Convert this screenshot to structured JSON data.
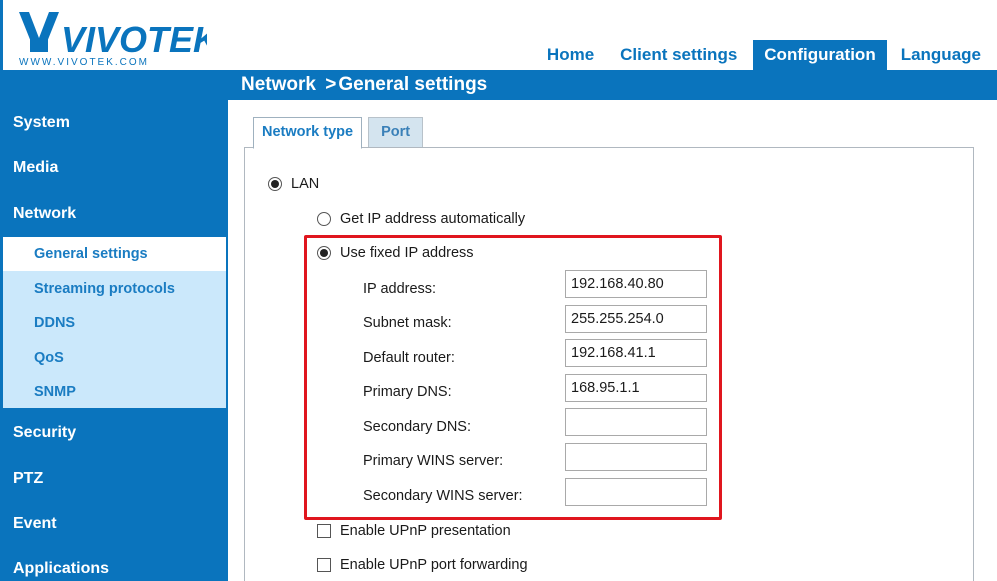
{
  "brand": {
    "name": "VIVOTEK",
    "url_text": "WWW.VIVOTEK.COM",
    "color": "#0a74bd"
  },
  "nav": {
    "home": "Home",
    "client_settings": "Client settings",
    "configuration": "Configuration",
    "language": "Language"
  },
  "title": {
    "section": "Network",
    "separator": ">",
    "page": "General settings"
  },
  "sidebar": {
    "main_top": [
      "System",
      "Media",
      "Network"
    ],
    "sub": [
      "General settings",
      "Streaming protocols",
      "DDNS",
      "QoS",
      "SNMP"
    ],
    "main_bottom": [
      "Security",
      "PTZ",
      "Event",
      "Applications"
    ]
  },
  "tabs": {
    "network_type": "Network type",
    "port": "Port"
  },
  "form": {
    "lan": "LAN",
    "auto_ip": "Get IP address automatically",
    "fixed_ip": "Use fixed IP address",
    "fields": [
      {
        "label": "IP address:",
        "value": "192.168.40.80"
      },
      {
        "label": "Subnet mask:",
        "value": "255.255.254.0"
      },
      {
        "label": "Default router:",
        "value": "192.168.41.1"
      },
      {
        "label": "Primary DNS:",
        "value": "168.95.1.1"
      },
      {
        "label": "Secondary DNS:",
        "value": ""
      },
      {
        "label": "Primary WINS server:",
        "value": ""
      },
      {
        "label": "Secondary WINS server:",
        "value": ""
      }
    ],
    "upnp_presentation": "Enable UPnP presentation",
    "upnp_port_forwarding": "Enable UPnP port forwarding"
  },
  "colors": {
    "highlight": "#e0161e",
    "submenu_bg": "#cbe8fb",
    "accent": "#1a7cc2"
  }
}
